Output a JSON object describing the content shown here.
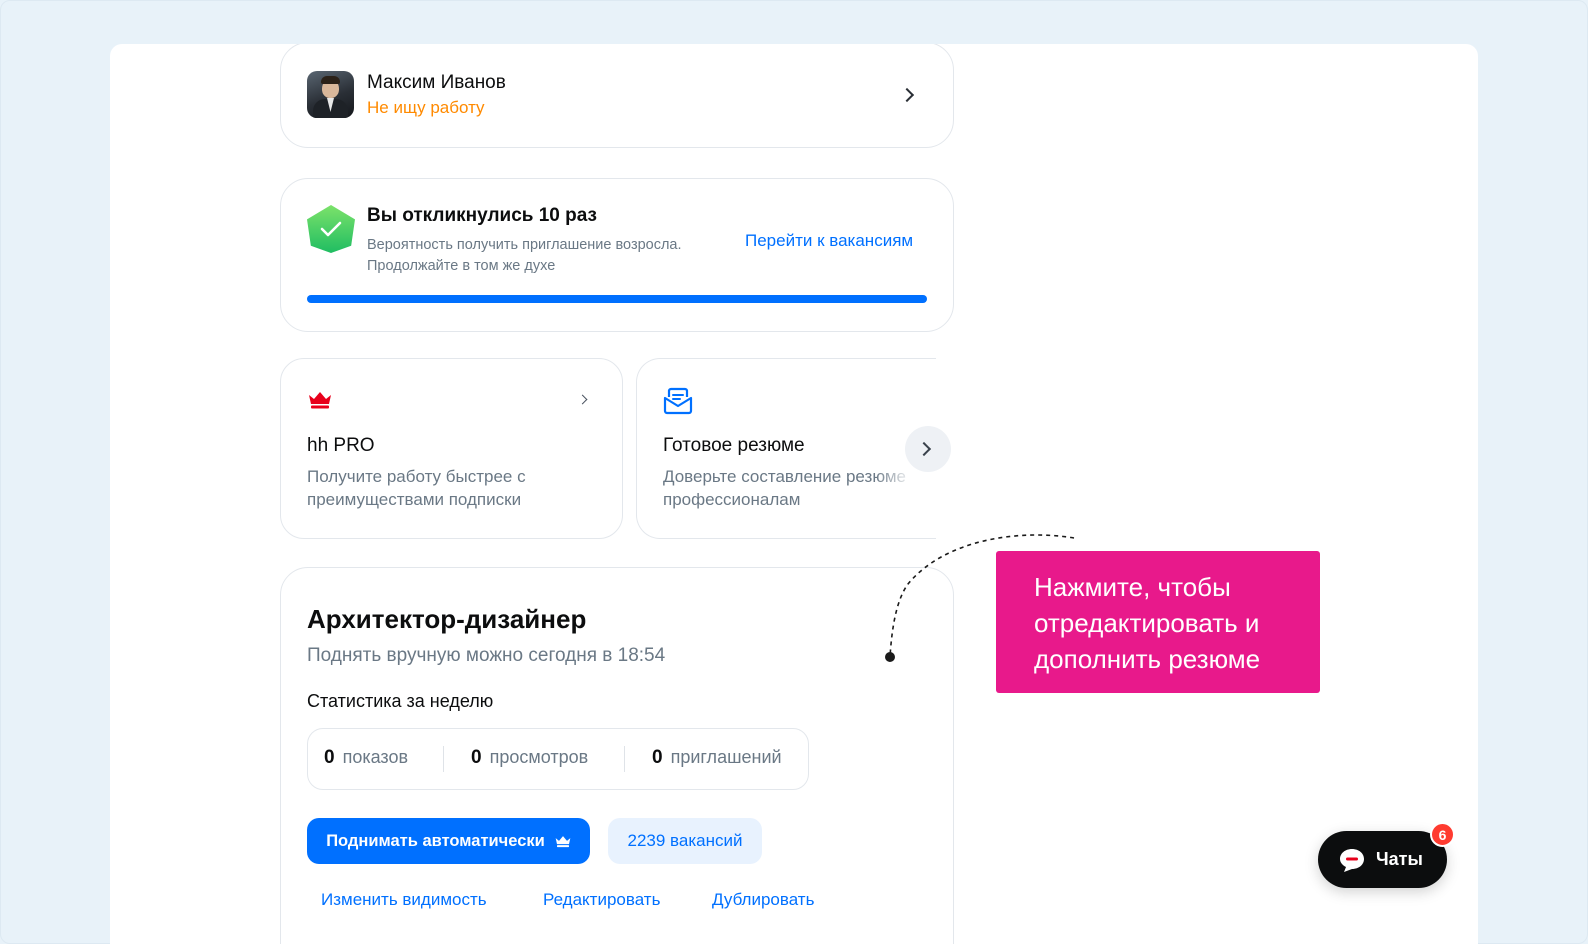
{
  "profile": {
    "name": "Максим Иванов",
    "status": "Не ищу работу"
  },
  "responses": {
    "title": "Вы откликнулись 10 раз",
    "description": "Вероятность получить приглашение возросла. Продолжайте в том же духе",
    "link_label": "Перейти к вакансиям",
    "progress": 1.0
  },
  "promo_cards": [
    {
      "icon": "crown-icon",
      "title": "hh PRO",
      "description": "Получите работу быстрее с преимуществами подписки"
    },
    {
      "icon": "envelope-icon",
      "title": "Готовое резюме",
      "description": "Доверьте составление резюме профессионалам"
    }
  ],
  "resume": {
    "title": "Архитектор-дизайнер",
    "subtitle": "Поднять вручную можно сегодня в 18:54",
    "stats_label": "Статистика за неделю",
    "stats": [
      {
        "value": "0",
        "label": "показов"
      },
      {
        "value": "0",
        "label": "просмотров"
      },
      {
        "value": "0",
        "label": "приглашений"
      }
    ],
    "auto_raise_label": "Поднимать автоматически",
    "vacancies_label": "2239 вакансий",
    "actions": [
      "Изменить видимость",
      "Редактировать",
      "Дублировать"
    ]
  },
  "callout": {
    "text": "Нажмите, чтобы отредактировать и дополнить резюме"
  },
  "chats": {
    "label": "Чаты",
    "badge": "6"
  },
  "colors": {
    "accent": "#0070ff",
    "status_orange": "#ff8a00",
    "callout_pink": "#e8198b",
    "pro_red": "#e8001c"
  }
}
